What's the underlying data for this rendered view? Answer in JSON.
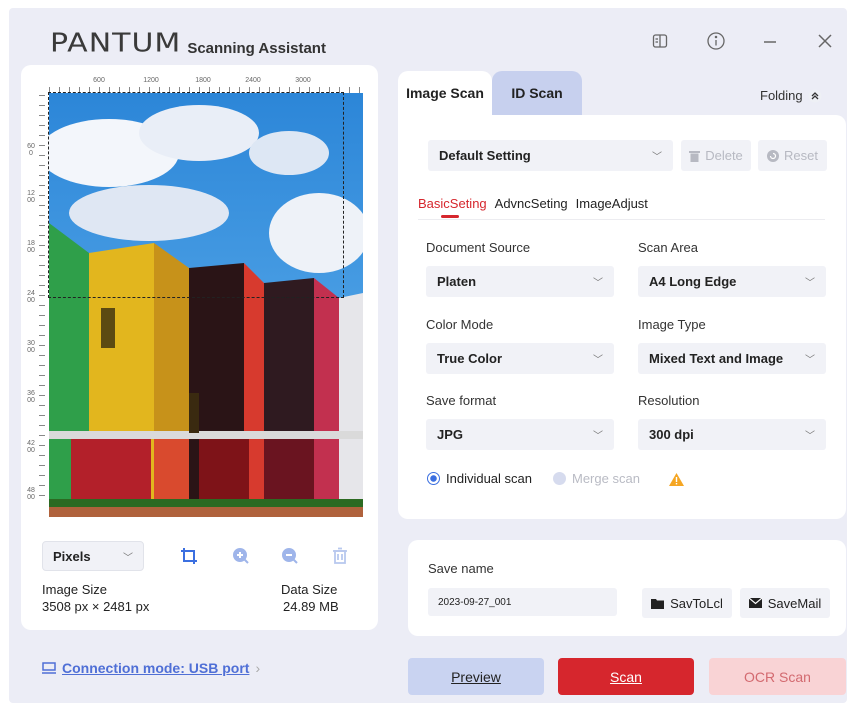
{
  "header": {
    "brand": "PANTUM",
    "app_name": "Scanning Assistant",
    "buttons": [
      {
        "icon": "manual-book-icon"
      },
      {
        "icon": "info-icon"
      },
      {
        "icon": "minimize-icon"
      },
      {
        "icon": "close-icon"
      }
    ]
  },
  "preview": {
    "ruler_top_ticks": [
      "600",
      "1200",
      "1800",
      "2400",
      "3000"
    ],
    "ruler_left_ticks": [
      "600",
      "1200",
      "1800",
      "2400",
      "3000",
      "3600",
      "4200",
      "4800"
    ],
    "unit_select": "Pixels",
    "image_size_label": "Image Size",
    "image_size_value": "3508 px × 2481 px",
    "data_size_label": "Data Size",
    "data_size_value": "24.89 MB"
  },
  "connection": {
    "label": "Connection mode: USB port",
    "chevron": "›"
  },
  "tabs": {
    "image_scan": "Image Scan",
    "id_scan": "ID Scan",
    "folding": "Folding"
  },
  "settings": {
    "preset": "Default Setting",
    "delete_label": "Delete",
    "reset_label": "Reset",
    "subtabs": [
      "BasicSeting",
      "AdvncSeting",
      "ImageAdjust"
    ],
    "document_source_label": "Document Source",
    "document_source_value": "Platen",
    "scan_area_label": "Scan Area",
    "scan_area_value": "A4 Long Edge",
    "color_mode_label": "Color Mode",
    "color_mode_value": "True Color",
    "image_type_label": "Image Type",
    "image_type_value": "Mixed Text and Image",
    "save_format_label": "Save format",
    "save_format_value": "JPG",
    "resolution_label": "Resolution",
    "resolution_value": "300 dpi",
    "individual_scan": "Individual scan",
    "merge_scan": "Merge scan"
  },
  "save": {
    "name_label": "Save name",
    "name_value": "2023-09-27_001",
    "save_local": "SavToLcl",
    "save_mail": "SaveMail"
  },
  "actions": {
    "preview_label": "Preview",
    "scan_label": "Scan",
    "ocr_label": "OCR Scan"
  },
  "colors": {
    "accent_red": "#d6262d",
    "link_blue": "#4f6fd6",
    "preview_button": "#c9d3f1",
    "ocr_button": "#f9d3d5",
    "radio_active": "#3b6fe0"
  }
}
